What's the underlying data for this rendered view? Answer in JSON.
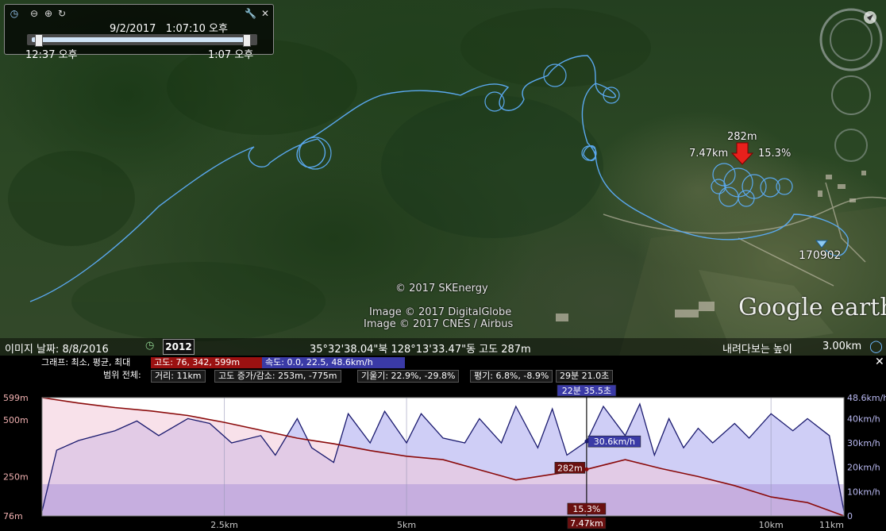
{
  "app": {
    "logo": "Google earth",
    "window_title": "Google Earth"
  },
  "tour_control": {
    "current_date": "9/2/2017",
    "current_time": "1:07:10 오후",
    "start_label": "12:37 오후",
    "end_label": "1:07 오후",
    "progress": 0.97
  },
  "map": {
    "copyright_lines": [
      "© 2017 SKEnergy",
      "Image © 2017 DigitalGlobe",
      "Image © 2017 CNES / Airbus"
    ],
    "marker": {
      "altitude": "282m",
      "distance": "7.47km",
      "slope": "15.3%"
    },
    "placemark_label": "170902"
  },
  "status_bar": {
    "imagery_date_label": "이미지 날짜: 8/8/2016",
    "year_badge": "2012",
    "coordinates": "35°32'38.04\"북 128°13'33.47\"동 고도   287m",
    "eye_alt_label": "내려다보는 높이",
    "eye_alt_value": "3.00km"
  },
  "profile_panel": {
    "row1_label": "그래프: 최소, 평균, 최대",
    "elevation_tag": "고도: 76, 342, 599m",
    "speed_tag": "속도: 0.0, 22.5, 48.6km/h",
    "row2_label": "범위 전체:",
    "stats_tags": [
      "거리: 11km",
      "고도 증가/감소: 253m, -775m",
      "기울기: 22.9%, -29.8%",
      "평기: 6.8%, -8.9%",
      "29분 21.0초"
    ],
    "close_icon": "close-icon"
  },
  "chart_data": {
    "type": "area",
    "x_unit": "km",
    "x_ticks": [
      "2.5km",
      "5km",
      "10km",
      "11km"
    ],
    "x_tick_values": [
      2.5,
      5,
      10,
      11
    ],
    "xlim": [
      0,
      11
    ],
    "left_ticks": [
      "599m",
      "500m",
      "250m",
      "76m"
    ],
    "left_tick_values": [
      599,
      500,
      250,
      76
    ],
    "left_ylim": [
      76,
      599
    ],
    "right_ticks": [
      "48.6km/h",
      "40km/h",
      "30km/h",
      "20km/h",
      "10km/h",
      "0"
    ],
    "right_tick_values": [
      48.6,
      40,
      30,
      20,
      10,
      0
    ],
    "right_ylim": [
      0,
      48.6
    ],
    "elevation_series": {
      "x": [
        0,
        0.5,
        1,
        1.5,
        2,
        2.5,
        3,
        3.5,
        4,
        4.5,
        5,
        5.5,
        6,
        6.5,
        7,
        7.47,
        8,
        8.5,
        9,
        9.5,
        10,
        10.5,
        11
      ],
      "y": [
        599,
        575,
        555,
        540,
        520,
        490,
        455,
        420,
        395,
        365,
        340,
        325,
        280,
        235,
        260,
        282,
        325,
        285,
        250,
        210,
        160,
        135,
        76
      ]
    },
    "speed_series": {
      "x": [
        0,
        0.2,
        0.5,
        1,
        1.3,
        1.6,
        2,
        2.3,
        2.6,
        3,
        3.2,
        3.5,
        3.7,
        4,
        4.2,
        4.5,
        4.7,
        5,
        5.2,
        5.5,
        5.8,
        6,
        6.3,
        6.5,
        6.8,
        7,
        7.2,
        7.47,
        7.7,
        8,
        8.2,
        8.4,
        8.6,
        8.8,
        9,
        9.2,
        9.5,
        9.7,
        10,
        10.3,
        10.5,
        10.8,
        11
      ],
      "y": [
        2,
        27,
        31,
        35,
        39,
        33,
        40,
        38,
        30,
        33,
        25,
        40,
        28,
        22,
        42,
        30,
        43,
        30,
        42,
        32,
        30,
        40,
        30,
        45,
        28,
        44,
        25,
        30.6,
        45,
        33,
        46,
        25,
        40,
        28,
        36,
        30,
        38,
        32,
        42,
        35,
        40,
        33,
        2
      ]
    },
    "cursor": {
      "x": 7.47,
      "time": "22분 35.5초",
      "altitude": "282m",
      "speed": "30.6km/h",
      "slope": "15.3%",
      "distance": "7.47km"
    },
    "colors": {
      "elevation_line": "#8a0a0a",
      "speed_line": "#1a1a6e",
      "elev_fill": "#f3c9d9",
      "speed_fill": "#c7c6f4",
      "elev_tag": "#9b1111",
      "speed_tag": "#3a3aa6"
    }
  }
}
